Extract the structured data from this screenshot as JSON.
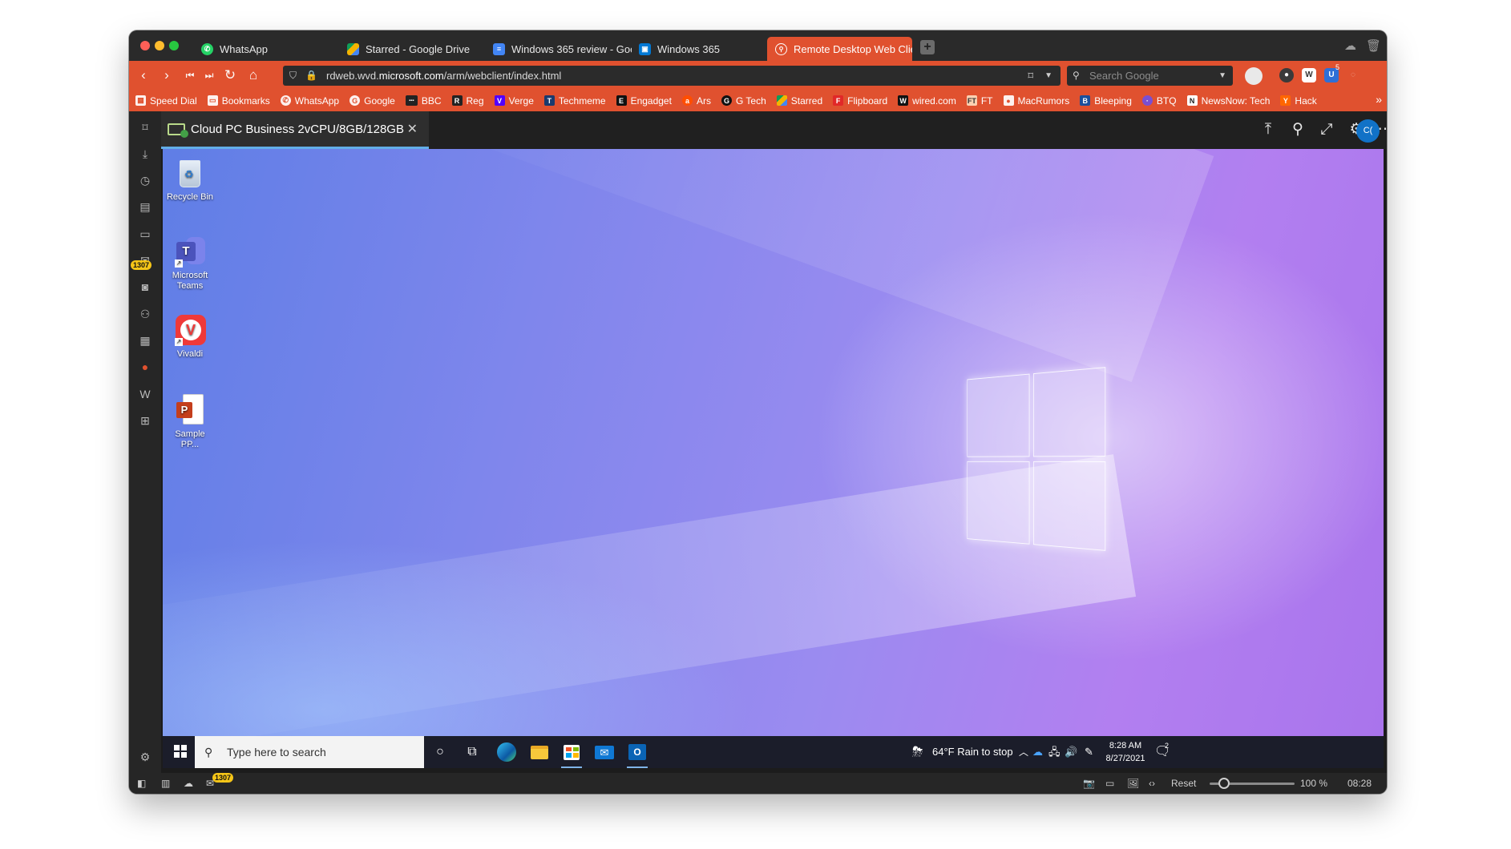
{
  "browser": {
    "tabs": [
      {
        "label": "WhatsApp",
        "icon": "whatsapp-icon",
        "color": "#25d366"
      },
      {
        "label": "Starred - Google Drive",
        "icon": "google-drive-icon",
        "color": "#f4b400"
      },
      {
        "label": "Windows 365 review - Goo",
        "icon": "google-docs-icon",
        "color": "#4285f4"
      },
      {
        "label": "Windows 365",
        "icon": "windows365-icon",
        "color": "#0078d4"
      },
      {
        "label": "Remote Desktop Web Clie",
        "icon": "remote-desktop-icon",
        "color": "#ffffff",
        "active": true
      }
    ],
    "address": {
      "prefix": "rdweb.wvd.",
      "host": "microsoft.com",
      "path": "/arm/webclient/index.html"
    },
    "search_placeholder": "Search Google",
    "extension_badge": "5",
    "bookmarks": [
      {
        "label": "Speed Dial",
        "icon": "speed-dial-icon"
      },
      {
        "label": "Bookmarks",
        "icon": "folder-icon"
      },
      {
        "label": "WhatsApp",
        "icon": "whatsapp-icon"
      },
      {
        "label": "Google",
        "icon": "google-icon"
      },
      {
        "label": "BBC",
        "icon": "bbc-icon"
      },
      {
        "label": "Reg",
        "icon": "reg-icon"
      },
      {
        "label": "Verge",
        "icon": "verge-icon"
      },
      {
        "label": "Techmeme",
        "icon": "techmeme-icon"
      },
      {
        "label": "Engadget",
        "icon": "engadget-icon"
      },
      {
        "label": "Ars",
        "icon": "ars-icon"
      },
      {
        "label": "G Tech",
        "icon": "gtech-icon"
      },
      {
        "label": "Starred",
        "icon": "google-drive-icon"
      },
      {
        "label": "Flipboard",
        "icon": "flipboard-icon"
      },
      {
        "label": "wired.com",
        "icon": "wired-icon"
      },
      {
        "label": "FT",
        "icon": "ft-icon"
      },
      {
        "label": "MacRumors",
        "icon": "macrumors-icon"
      },
      {
        "label": "Bleeping",
        "icon": "bleeping-icon"
      },
      {
        "label": "BTQ",
        "icon": "btq-icon"
      },
      {
        "label": "NewsNow: Tech",
        "icon": "newsnow-icon"
      },
      {
        "label": "Hack",
        "icon": "hackernews-icon"
      }
    ],
    "side_badge": "1307",
    "status_badge": "1307",
    "status": {
      "reset_label": "Reset",
      "zoom": "100 %",
      "zoom_value": 100,
      "time": "08:28"
    }
  },
  "rd": {
    "session_tab": "Cloud PC Business 2vCPU/8GB/128GB",
    "avatar_initials": "C(",
    "desktop_icons": [
      {
        "label": "Recycle Bin",
        "icon": "recycle-bin-icon"
      },
      {
        "label": "Microsoft Teams",
        "icon": "teams-icon"
      },
      {
        "label": "Vivaldi",
        "icon": "vivaldi-icon"
      },
      {
        "label": "Sample PP...",
        "icon": "powerpoint-icon"
      }
    ],
    "taskbar": {
      "search_placeholder": "Type here to search",
      "weather": "64°F  Rain to stop",
      "time": "8:28 AM",
      "date": "8/27/2021",
      "notification_count": "2"
    }
  },
  "colors": {
    "accent": "#e0512f",
    "taskbar": "#1b1d2a",
    "rd_tab_underline": "#62aee8"
  }
}
